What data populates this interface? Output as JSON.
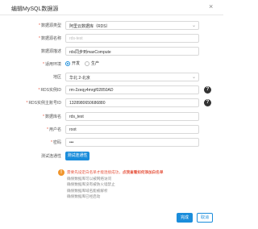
{
  "dialog": {
    "title": "编辑MySQL数据源",
    "close": "×"
  },
  "form": {
    "type": {
      "label": "数据源类型",
      "required": "*",
      "value": "阿里云数据库（RDS）"
    },
    "name": {
      "label": "数据源名称",
      "required": "*",
      "value": "rds-test"
    },
    "desc": {
      "label": "数据源描述",
      "value": "rds同步到maxCompute"
    },
    "env": {
      "label": "适用环境",
      "required": "*",
      "options": [
        "开发",
        "生产"
      ],
      "selected": "开发"
    },
    "region": {
      "label": "地区",
      "value": "华北 2-北京"
    },
    "instance": {
      "label": "RDS实例ID",
      "required": "*",
      "value": "rm-2zeqy4mrgf02850AD"
    },
    "owner": {
      "label": "RDS实例主账号ID",
      "required": "*",
      "value": "1328980650686880"
    },
    "dbname": {
      "label": "数据库名",
      "required": "*",
      "value": "rds_test"
    },
    "user": {
      "label": "用户名",
      "required": "*",
      "value": "root"
    },
    "password": {
      "label": "密码",
      "required": "*",
      "value": "•••"
    },
    "test": {
      "label": "测试连通性",
      "button": "测试连通性"
    }
  },
  "notice": {
    "line1": "需要先设定白名单才能连接成功，",
    "link": "点我查看如何添加白名单",
    "lines": [
      "确保数据库可以被网络访问",
      "确保数据库没有被防火墙禁止",
      "确保数据库域名能被解析",
      "确保数据库已经启动"
    ]
  },
  "footer": {
    "ok": "完成",
    "cancel": "取消"
  },
  "icons": {
    "help": "help-icon",
    "warning": "warning-icon",
    "chevron": "chevron-down-icon"
  }
}
